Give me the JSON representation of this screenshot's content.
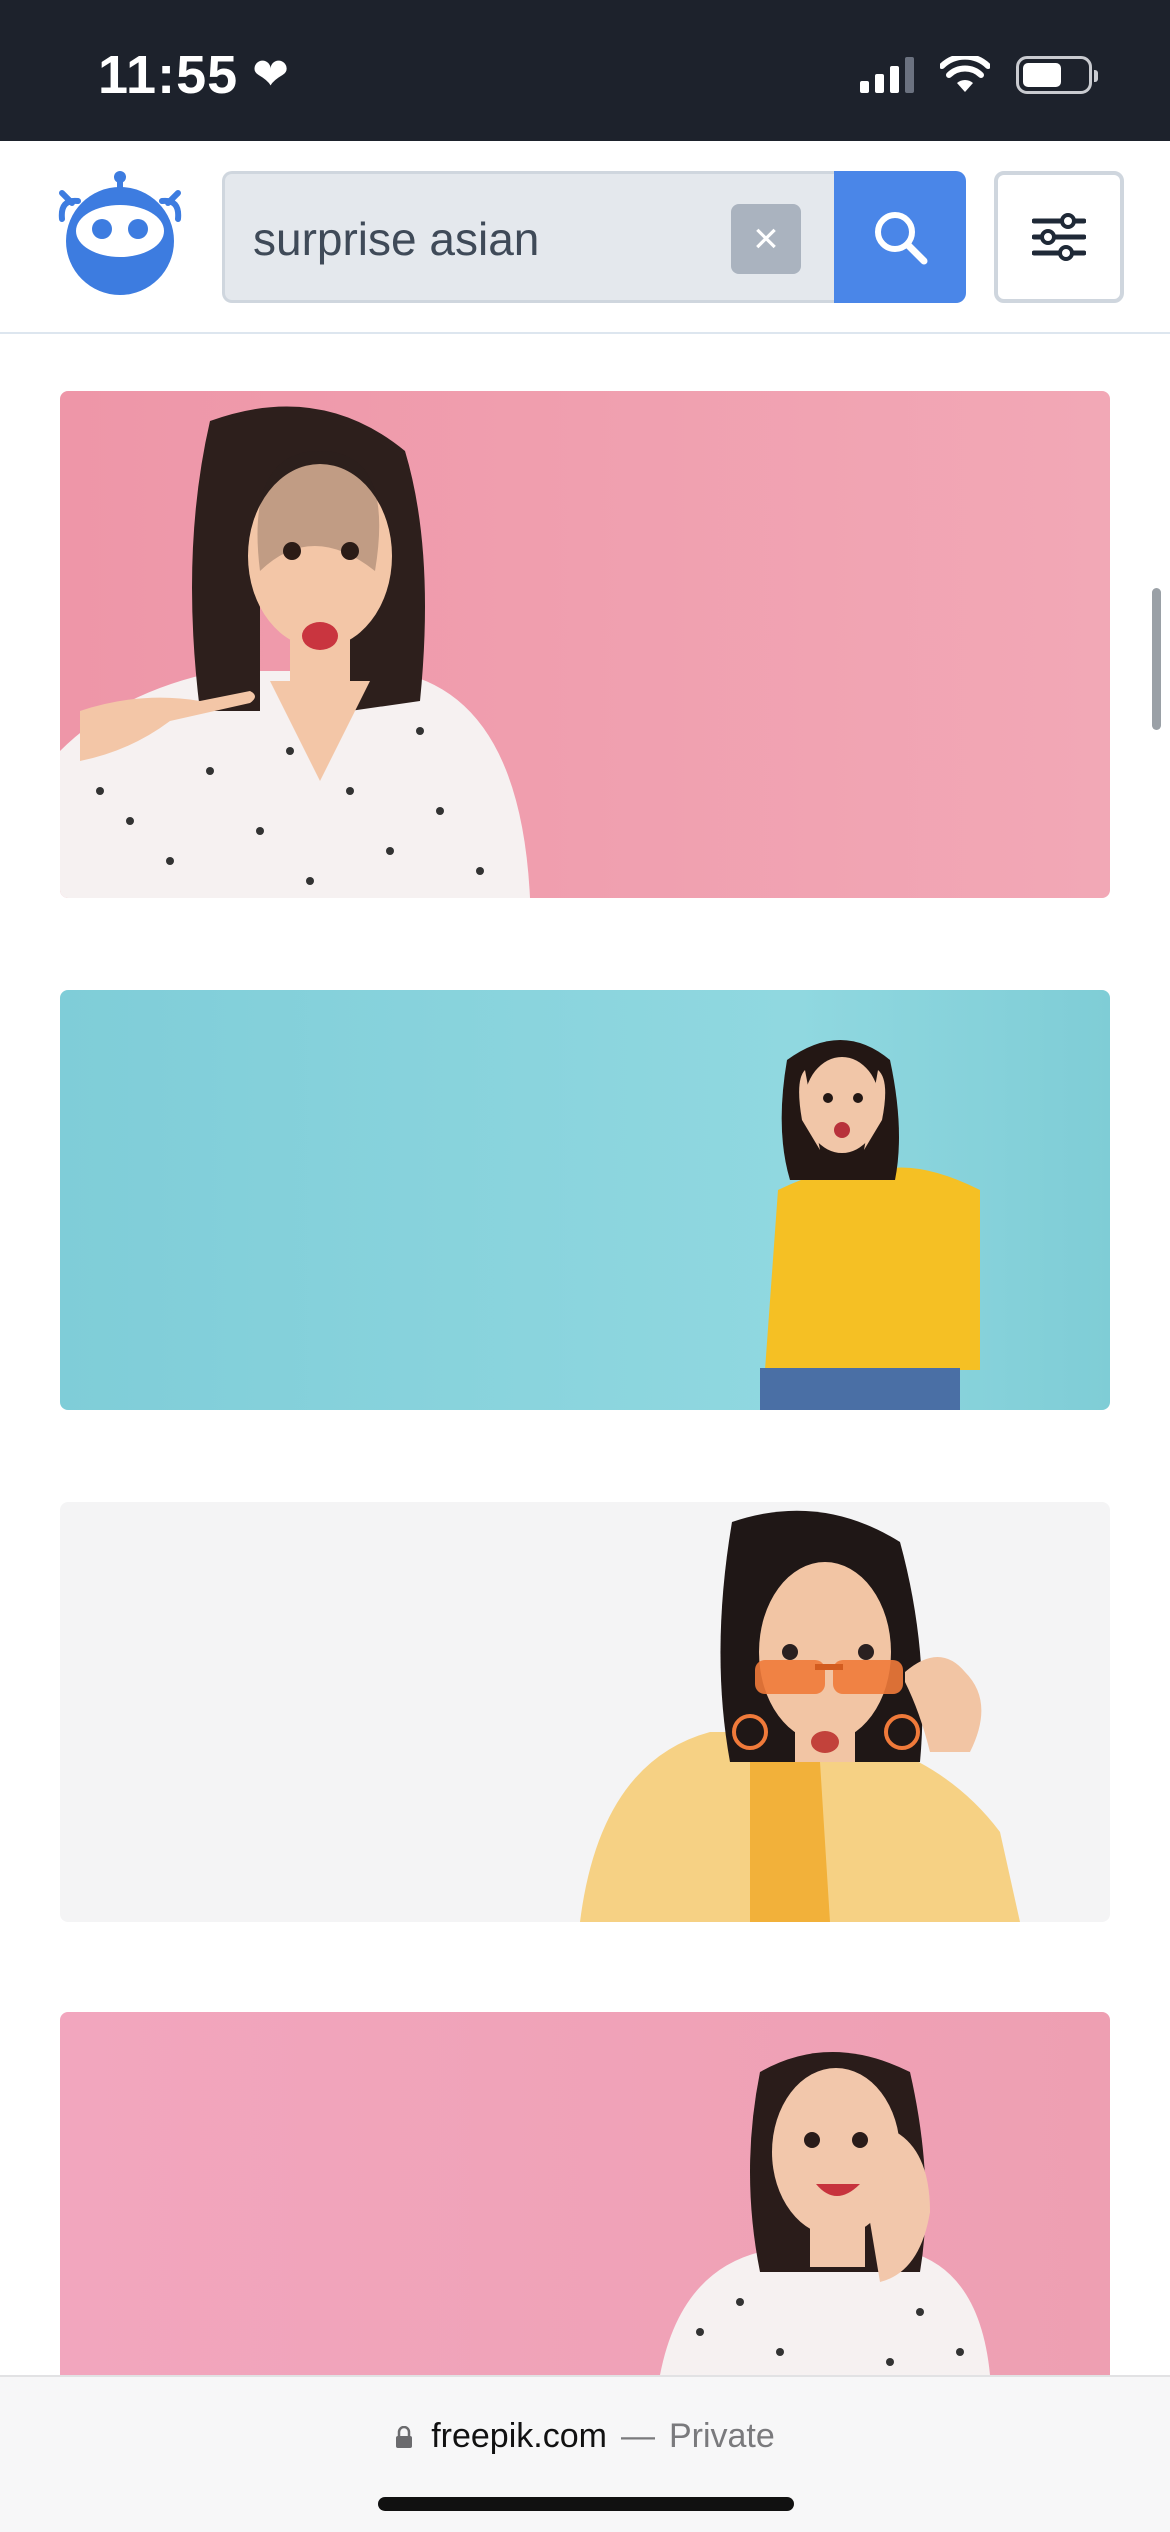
{
  "status_bar": {
    "time": "11:55",
    "heart_icon": "heart-icon",
    "signal_icon": "cellular-signal-icon",
    "wifi_icon": "wifi-icon",
    "battery_icon": "battery-icon",
    "battery_level_percent": 62
  },
  "header": {
    "logo_icon": "freepik-robot-logo",
    "search": {
      "value": "surprise asian",
      "clear_label": "×",
      "search_icon": "search-icon"
    },
    "filter_icon": "sliders-icon"
  },
  "results": [
    {
      "name": "result-image-1",
      "description_icon": "photo",
      "background": "#f0a2b2"
    },
    {
      "name": "result-image-2",
      "description_icon": "photo",
      "background": "#8dd3dc"
    },
    {
      "name": "result-image-3",
      "description_icon": "photo",
      "background": "#f4f4f5"
    },
    {
      "name": "result-image-4",
      "description_icon": "photo",
      "background": "#f0a3b5"
    }
  ],
  "browser_bar": {
    "lock_icon": "lock-icon",
    "domain": "freepik.com",
    "separator": "—",
    "mode": "Private"
  },
  "colors": {
    "status_bar_bg": "#1d222c",
    "accent_blue": "#4a86e8",
    "search_bg": "#e4e8ed"
  }
}
